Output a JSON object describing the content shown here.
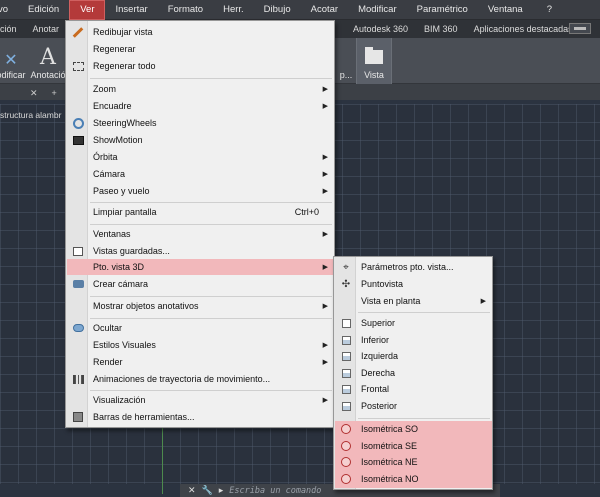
{
  "menubar": {
    "items": [
      {
        "label": "vo"
      },
      {
        "label": "Edición"
      },
      {
        "label": "Ver"
      },
      {
        "label": "Insertar"
      },
      {
        "label": "Formato"
      },
      {
        "label": "Herr."
      },
      {
        "label": "Dibujo"
      },
      {
        "label": "Acotar"
      },
      {
        "label": "Modificar"
      },
      {
        "label": "Paramétrico"
      },
      {
        "label": "Ventana"
      },
      {
        "label": "?"
      }
    ]
  },
  "ribbon_tabs": {
    "left": [
      "rción",
      "Anotar"
    ],
    "right": [
      "Autodesk 360",
      "BIM 360",
      "Aplicaciones destacadas"
    ]
  },
  "ribbon": {
    "modificar_label": "odificar",
    "anotacion_label": "Anotació",
    "anotacion_glyph": "A",
    "partial_label": "p...",
    "vista_label": "Vista"
  },
  "file_tabs": {
    "close": "✕",
    "add": "+"
  },
  "viewport_label": "structura alambr",
  "command_line": {
    "placeholder": "Escriba un comando"
  },
  "view_menu": {
    "redibujar": "Redibujar vista",
    "regenerar": "Regenerar",
    "regenerar_todo": "Regenerar todo",
    "zoom": "Zoom",
    "encuadre": "Encuadre",
    "steeringwheels": "SteeringWheels",
    "showmotion": "ShowMotion",
    "orbita": "Órbita",
    "camara": "Cámara",
    "paseo": "Paseo y vuelo",
    "limpiar": "Limpiar pantalla",
    "limpiar_shortcut": "Ctrl+0",
    "ventanas": "Ventanas",
    "vistas_guardadas": "Vistas guardadas...",
    "pto_vista": "Pto. vista 3D",
    "crear_camara": "Crear cámara",
    "mostrar_objetos": "Mostrar objetos anotativos",
    "ocultar": "Ocultar",
    "estilos": "Estilos Visuales",
    "render": "Render",
    "animaciones": "Animaciones de trayectoria de movimiento...",
    "visualizacion": "Visualización",
    "barras": "Barras de herramientas..."
  },
  "viewpoint_submenu": {
    "parametros": "Parámetros pto. vista...",
    "puntovista": "Puntovista",
    "vista_planta": "Vista en planta",
    "superior": "Superior",
    "inferior": "Inferior",
    "izquierda": "Izquierda",
    "derecha": "Derecha",
    "frontal": "Frontal",
    "posterior": "Posterior",
    "iso_so": "Isométrica SO",
    "iso_se": "Isométrica SE",
    "iso_ne": "Isométrica NE",
    "iso_no": "Isométrica NO"
  },
  "colors": {
    "menu_highlight": "#f2b8bb",
    "active_menu": "#b43a3a",
    "canvas": "#2a313d",
    "y_axis": "#4d8a4d"
  }
}
